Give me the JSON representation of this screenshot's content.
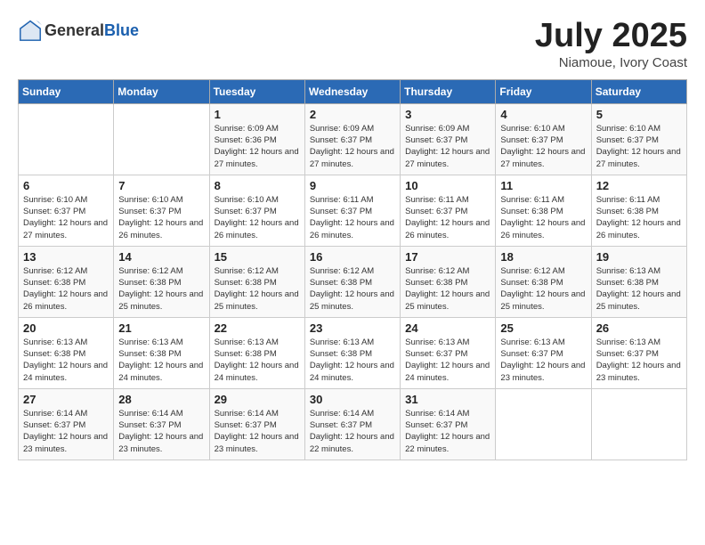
{
  "header": {
    "logo_general": "General",
    "logo_blue": "Blue",
    "month_year": "July 2025",
    "location": "Niamoue, Ivory Coast"
  },
  "weekdays": [
    "Sunday",
    "Monday",
    "Tuesday",
    "Wednesday",
    "Thursday",
    "Friday",
    "Saturday"
  ],
  "weeks": [
    [
      {
        "day": "",
        "sunrise": "",
        "sunset": "",
        "daylight": ""
      },
      {
        "day": "",
        "sunrise": "",
        "sunset": "",
        "daylight": ""
      },
      {
        "day": "1",
        "sunrise": "Sunrise: 6:09 AM",
        "sunset": "Sunset: 6:36 PM",
        "daylight": "Daylight: 12 hours and 27 minutes."
      },
      {
        "day": "2",
        "sunrise": "Sunrise: 6:09 AM",
        "sunset": "Sunset: 6:37 PM",
        "daylight": "Daylight: 12 hours and 27 minutes."
      },
      {
        "day": "3",
        "sunrise": "Sunrise: 6:09 AM",
        "sunset": "Sunset: 6:37 PM",
        "daylight": "Daylight: 12 hours and 27 minutes."
      },
      {
        "day": "4",
        "sunrise": "Sunrise: 6:10 AM",
        "sunset": "Sunset: 6:37 PM",
        "daylight": "Daylight: 12 hours and 27 minutes."
      },
      {
        "day": "5",
        "sunrise": "Sunrise: 6:10 AM",
        "sunset": "Sunset: 6:37 PM",
        "daylight": "Daylight: 12 hours and 27 minutes."
      }
    ],
    [
      {
        "day": "6",
        "sunrise": "Sunrise: 6:10 AM",
        "sunset": "Sunset: 6:37 PM",
        "daylight": "Daylight: 12 hours and 27 minutes."
      },
      {
        "day": "7",
        "sunrise": "Sunrise: 6:10 AM",
        "sunset": "Sunset: 6:37 PM",
        "daylight": "Daylight: 12 hours and 26 minutes."
      },
      {
        "day": "8",
        "sunrise": "Sunrise: 6:10 AM",
        "sunset": "Sunset: 6:37 PM",
        "daylight": "Daylight: 12 hours and 26 minutes."
      },
      {
        "day": "9",
        "sunrise": "Sunrise: 6:11 AM",
        "sunset": "Sunset: 6:37 PM",
        "daylight": "Daylight: 12 hours and 26 minutes."
      },
      {
        "day": "10",
        "sunrise": "Sunrise: 6:11 AM",
        "sunset": "Sunset: 6:37 PM",
        "daylight": "Daylight: 12 hours and 26 minutes."
      },
      {
        "day": "11",
        "sunrise": "Sunrise: 6:11 AM",
        "sunset": "Sunset: 6:38 PM",
        "daylight": "Daylight: 12 hours and 26 minutes."
      },
      {
        "day": "12",
        "sunrise": "Sunrise: 6:11 AM",
        "sunset": "Sunset: 6:38 PM",
        "daylight": "Daylight: 12 hours and 26 minutes."
      }
    ],
    [
      {
        "day": "13",
        "sunrise": "Sunrise: 6:12 AM",
        "sunset": "Sunset: 6:38 PM",
        "daylight": "Daylight: 12 hours and 26 minutes."
      },
      {
        "day": "14",
        "sunrise": "Sunrise: 6:12 AM",
        "sunset": "Sunset: 6:38 PM",
        "daylight": "Daylight: 12 hours and 25 minutes."
      },
      {
        "day": "15",
        "sunrise": "Sunrise: 6:12 AM",
        "sunset": "Sunset: 6:38 PM",
        "daylight": "Daylight: 12 hours and 25 minutes."
      },
      {
        "day": "16",
        "sunrise": "Sunrise: 6:12 AM",
        "sunset": "Sunset: 6:38 PM",
        "daylight": "Daylight: 12 hours and 25 minutes."
      },
      {
        "day": "17",
        "sunrise": "Sunrise: 6:12 AM",
        "sunset": "Sunset: 6:38 PM",
        "daylight": "Daylight: 12 hours and 25 minutes."
      },
      {
        "day": "18",
        "sunrise": "Sunrise: 6:12 AM",
        "sunset": "Sunset: 6:38 PM",
        "daylight": "Daylight: 12 hours and 25 minutes."
      },
      {
        "day": "19",
        "sunrise": "Sunrise: 6:13 AM",
        "sunset": "Sunset: 6:38 PM",
        "daylight": "Daylight: 12 hours and 25 minutes."
      }
    ],
    [
      {
        "day": "20",
        "sunrise": "Sunrise: 6:13 AM",
        "sunset": "Sunset: 6:38 PM",
        "daylight": "Daylight: 12 hours and 24 minutes."
      },
      {
        "day": "21",
        "sunrise": "Sunrise: 6:13 AM",
        "sunset": "Sunset: 6:38 PM",
        "daylight": "Daylight: 12 hours and 24 minutes."
      },
      {
        "day": "22",
        "sunrise": "Sunrise: 6:13 AM",
        "sunset": "Sunset: 6:38 PM",
        "daylight": "Daylight: 12 hours and 24 minutes."
      },
      {
        "day": "23",
        "sunrise": "Sunrise: 6:13 AM",
        "sunset": "Sunset: 6:38 PM",
        "daylight": "Daylight: 12 hours and 24 minutes."
      },
      {
        "day": "24",
        "sunrise": "Sunrise: 6:13 AM",
        "sunset": "Sunset: 6:37 PM",
        "daylight": "Daylight: 12 hours and 24 minutes."
      },
      {
        "day": "25",
        "sunrise": "Sunrise: 6:13 AM",
        "sunset": "Sunset: 6:37 PM",
        "daylight": "Daylight: 12 hours and 23 minutes."
      },
      {
        "day": "26",
        "sunrise": "Sunrise: 6:13 AM",
        "sunset": "Sunset: 6:37 PM",
        "daylight": "Daylight: 12 hours and 23 minutes."
      }
    ],
    [
      {
        "day": "27",
        "sunrise": "Sunrise: 6:14 AM",
        "sunset": "Sunset: 6:37 PM",
        "daylight": "Daylight: 12 hours and 23 minutes."
      },
      {
        "day": "28",
        "sunrise": "Sunrise: 6:14 AM",
        "sunset": "Sunset: 6:37 PM",
        "daylight": "Daylight: 12 hours and 23 minutes."
      },
      {
        "day": "29",
        "sunrise": "Sunrise: 6:14 AM",
        "sunset": "Sunset: 6:37 PM",
        "daylight": "Daylight: 12 hours and 23 minutes."
      },
      {
        "day": "30",
        "sunrise": "Sunrise: 6:14 AM",
        "sunset": "Sunset: 6:37 PM",
        "daylight": "Daylight: 12 hours and 22 minutes."
      },
      {
        "day": "31",
        "sunrise": "Sunrise: 6:14 AM",
        "sunset": "Sunset: 6:37 PM",
        "daylight": "Daylight: 12 hours and 22 minutes."
      },
      {
        "day": "",
        "sunrise": "",
        "sunset": "",
        "daylight": ""
      },
      {
        "day": "",
        "sunrise": "",
        "sunset": "",
        "daylight": ""
      }
    ]
  ]
}
